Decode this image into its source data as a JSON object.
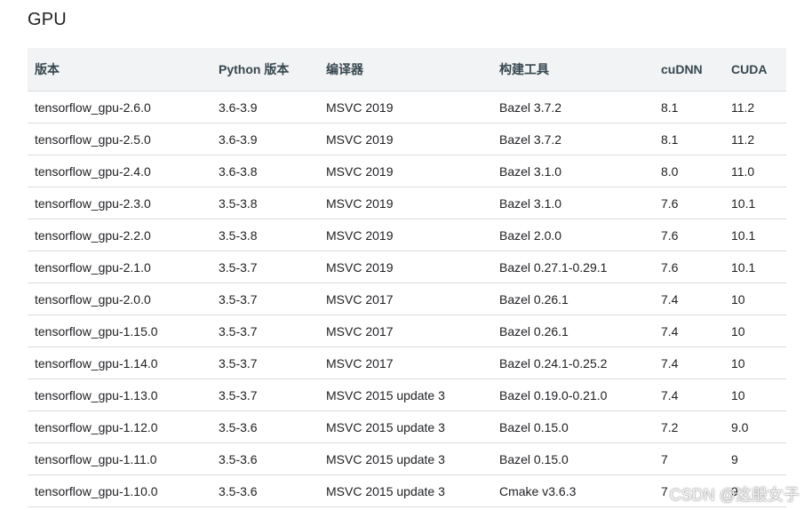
{
  "heading": "GPU",
  "table": {
    "headers": [
      "版本",
      "Python 版本",
      "编译器",
      "构建工具",
      "cuDNN",
      "CUDA"
    ],
    "rows": [
      [
        "tensorflow_gpu-2.6.0",
        "3.6-3.9",
        "MSVC 2019",
        "Bazel 3.7.2",
        "8.1",
        "11.2"
      ],
      [
        "tensorflow_gpu-2.5.0",
        "3.6-3.9",
        "MSVC 2019",
        "Bazel 3.7.2",
        "8.1",
        "11.2"
      ],
      [
        "tensorflow_gpu-2.4.0",
        "3.6-3.8",
        "MSVC 2019",
        "Bazel 3.1.0",
        "8.0",
        "11.0"
      ],
      [
        "tensorflow_gpu-2.3.0",
        "3.5-3.8",
        "MSVC 2019",
        "Bazel 3.1.0",
        "7.6",
        "10.1"
      ],
      [
        "tensorflow_gpu-2.2.0",
        "3.5-3.8",
        "MSVC 2019",
        "Bazel 2.0.0",
        "7.6",
        "10.1"
      ],
      [
        "tensorflow_gpu-2.1.0",
        "3.5-3.7",
        "MSVC 2019",
        "Bazel 0.27.1-0.29.1",
        "7.6",
        "10.1"
      ],
      [
        "tensorflow_gpu-2.0.0",
        "3.5-3.7",
        "MSVC 2017",
        "Bazel 0.26.1",
        "7.4",
        "10"
      ],
      [
        "tensorflow_gpu-1.15.0",
        "3.5-3.7",
        "MSVC 2017",
        "Bazel 0.26.1",
        "7.4",
        "10"
      ],
      [
        "tensorflow_gpu-1.14.0",
        "3.5-3.7",
        "MSVC 2017",
        "Bazel 0.24.1-0.25.2",
        "7.4",
        "10"
      ],
      [
        "tensorflow_gpu-1.13.0",
        "3.5-3.7",
        "MSVC 2015 update 3",
        "Bazel 0.19.0-0.21.0",
        "7.4",
        "10"
      ],
      [
        "tensorflow_gpu-1.12.0",
        "3.5-3.6",
        "MSVC 2015 update 3",
        "Bazel 0.15.0",
        "7.2",
        "9.0"
      ],
      [
        "tensorflow_gpu-1.11.0",
        "3.5-3.6",
        "MSVC 2015 update 3",
        "Bazel 0.15.0",
        "7",
        "9"
      ],
      [
        "tensorflow_gpu-1.10.0",
        "3.5-3.6",
        "MSVC 2015 update 3",
        "Cmake v3.6.3",
        "7",
        "9"
      ]
    ]
  },
  "watermark": "CSDN @这般女子"
}
